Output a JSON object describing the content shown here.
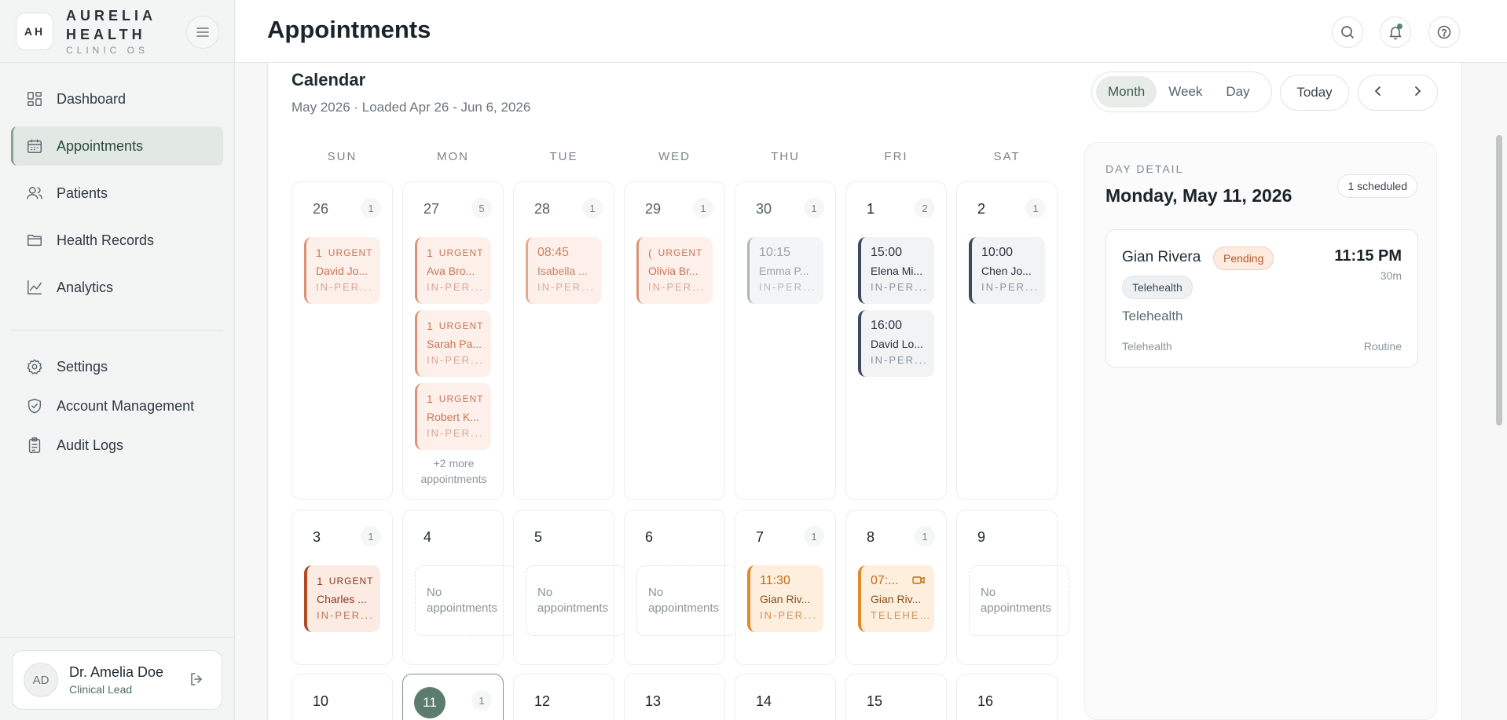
{
  "brand": {
    "logo": "AH",
    "line1": "AURELIA",
    "line2": "HEALTH",
    "sub": "CLINIC OS"
  },
  "nav": [
    {
      "label": "Dashboard",
      "icon": "grid-icon",
      "active": false
    },
    {
      "label": "Appointments",
      "icon": "calendar-icon",
      "active": true
    },
    {
      "label": "Patients",
      "icon": "users-icon",
      "active": false
    },
    {
      "label": "Health Records",
      "icon": "folder-icon",
      "active": false
    },
    {
      "label": "Analytics",
      "icon": "chart-icon",
      "active": false
    }
  ],
  "nav2": [
    {
      "label": "Settings",
      "icon": "gear-icon"
    },
    {
      "label": "Account Management",
      "icon": "shield-icon"
    },
    {
      "label": "Audit Logs",
      "icon": "clipboard-icon"
    }
  ],
  "user": {
    "initials": "AD",
    "name": "Dr. Amelia Doe",
    "role": "Clinical Lead"
  },
  "header": {
    "title": "Appointments"
  },
  "calendar": {
    "title": "Calendar",
    "subtitle": "May 2026 · Loaded Apr 26 - Jun 6, 2026",
    "views": [
      "Month",
      "Week",
      "Day"
    ],
    "active_view": "Month",
    "today": "Today",
    "weekdays": [
      "SUN",
      "MON",
      "TUE",
      "WED",
      "THU",
      "FRI",
      "SAT"
    ],
    "empty_label": "No appointments",
    "weeks": [
      [
        {
          "day": "26",
          "count": "1",
          "current": false,
          "appts": [
            {
              "style": "urgent",
              "num": "1",
              "urgent": "URGENT",
              "name": "David Jo...",
              "mode": "IN-PER..."
            }
          ]
        },
        {
          "day": "27",
          "count": "5",
          "current": false,
          "appts": [
            {
              "style": "urgent",
              "num": "1",
              "urgent": "URGENT",
              "name": "Ava Bro...",
              "mode": "IN-PER..."
            },
            {
              "style": "urgent",
              "num": "1",
              "urgent": "URGENT",
              "name": "Sarah Pa...",
              "mode": "IN-PER..."
            },
            {
              "style": "urgent",
              "num": "1",
              "urgent": "URGENT",
              "name": "Robert K...",
              "mode": "IN-PER..."
            }
          ],
          "more": "+2 more appointments"
        },
        {
          "day": "28",
          "count": "1",
          "current": false,
          "appts": [
            {
              "style": "peach",
              "time": "08:45",
              "name": "Isabella ...",
              "mode": "IN-PER..."
            }
          ]
        },
        {
          "day": "29",
          "count": "1",
          "current": false,
          "appts": [
            {
              "style": "urgent",
              "num": "(",
              "urgent": "URGENT",
              "name": "Olivia Br...",
              "mode": "IN-PER..."
            }
          ]
        },
        {
          "day": "30",
          "count": "1",
          "current": false,
          "appts": [
            {
              "style": "grey",
              "time": "10:15",
              "name": "Emma P...",
              "mode": "IN-PER..."
            }
          ]
        },
        {
          "day": "1",
          "count": "2",
          "current": true,
          "appts": [
            {
              "style": "dark",
              "time": "15:00",
              "name": "Elena Mi...",
              "mode": "IN-PER..."
            },
            {
              "style": "dark",
              "time": "16:00",
              "name": "David Lo...",
              "mode": "IN-PER..."
            }
          ]
        },
        {
          "day": "2",
          "count": "1",
          "current": true,
          "appts": [
            {
              "style": "dark",
              "time": "10:00",
              "name": "Chen Jo...",
              "mode": "IN-PER..."
            }
          ]
        }
      ],
      [
        {
          "day": "3",
          "count": "1",
          "current": true,
          "appts": [
            {
              "style": "urgent-dark",
              "num": "1",
              "urgent": "URGENT",
              "name": "Charles ...",
              "mode": "IN-PER..."
            }
          ]
        },
        {
          "day": "4",
          "count": "",
          "current": true,
          "appts": [],
          "empty": true
        },
        {
          "day": "5",
          "count": "",
          "current": true,
          "appts": [],
          "empty": true
        },
        {
          "day": "6",
          "count": "",
          "current": true,
          "appts": [],
          "empty": true
        },
        {
          "day": "7",
          "count": "1",
          "current": true,
          "appts": [
            {
              "style": "orange",
              "time": "11:30",
              "name": "Gian Riv...",
              "mode": "IN-PER..."
            }
          ]
        },
        {
          "day": "8",
          "count": "1",
          "current": true,
          "appts": [
            {
              "style": "orange",
              "time": "07:...",
              "name": "Gian Riv...",
              "mode": "TELEHE...",
              "video": true
            }
          ]
        },
        {
          "day": "9",
          "count": "",
          "current": true,
          "appts": [],
          "empty": true
        }
      ],
      [
        {
          "day": "10",
          "count": "",
          "current": true,
          "appts": []
        },
        {
          "day": "11",
          "count": "1",
          "current": true,
          "selected": true,
          "appts": []
        },
        {
          "day": "12",
          "count": "",
          "current": true,
          "appts": []
        },
        {
          "day": "13",
          "count": "",
          "current": true,
          "appts": []
        },
        {
          "day": "14",
          "count": "",
          "current": true,
          "appts": []
        },
        {
          "day": "15",
          "count": "",
          "current": true,
          "appts": []
        },
        {
          "day": "16",
          "count": "",
          "current": true,
          "appts": []
        }
      ]
    ]
  },
  "day_detail": {
    "label": "DAY DETAIL",
    "date": "Monday, May 11, 2026",
    "badge": "1 scheduled",
    "card": {
      "name": "Gian Rivera",
      "status": "Pending",
      "time": "11:15 PM",
      "duration": "30m",
      "chip": "Telehealth",
      "type": "Telehealth",
      "foot_left": "Telehealth",
      "foot_right": "Routine"
    }
  }
}
